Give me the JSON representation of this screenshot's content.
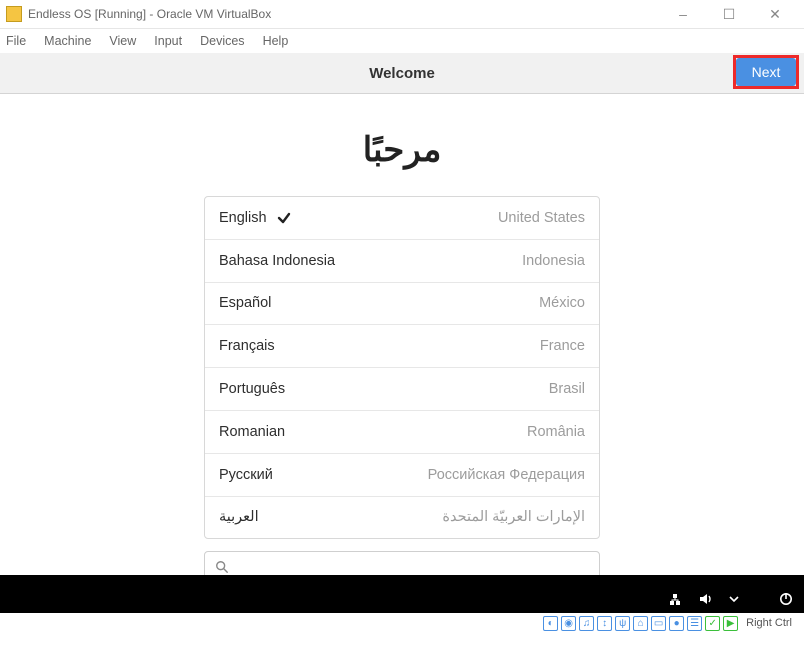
{
  "host_window": {
    "title": "Endless OS [Running] - Oracle VM VirtualBox",
    "menu": [
      "File",
      "Machine",
      "View",
      "Input",
      "Devices",
      "Help"
    ],
    "controls": {
      "minimize": "–",
      "maximize": "☐",
      "close": "✕"
    },
    "status": {
      "icons": [
        "disk",
        "optical",
        "audio",
        "net",
        "usb",
        "shared",
        "display",
        "record",
        "vrde",
        "guest-additions",
        "cpu"
      ],
      "hostkey": "Right Ctrl"
    }
  },
  "guest": {
    "headerbar": {
      "title": "Welcome",
      "next": "Next"
    },
    "welcome_heading": "مرحبًا",
    "languages": [
      {
        "name": "English",
        "country": "United States",
        "selected": true
      },
      {
        "name": "Bahasa Indonesia",
        "country": "Indonesia",
        "selected": false
      },
      {
        "name": "Español",
        "country": "México",
        "selected": false
      },
      {
        "name": "Français",
        "country": "France",
        "selected": false
      },
      {
        "name": "Português",
        "country": "Brasil",
        "selected": false
      },
      {
        "name": "Romanian",
        "country": "România",
        "selected": false
      },
      {
        "name": "Русский",
        "country": "Российская Федерация",
        "selected": false
      },
      {
        "name": "العربية",
        "country": "الإمارات العربيّة المتحدة",
        "selected": false
      }
    ],
    "search": {
      "value": "",
      "placeholder": ""
    },
    "topbar": {
      "items": [
        "network-icon",
        "volume-icon",
        "dropdown-icon",
        "power-icon"
      ]
    }
  }
}
